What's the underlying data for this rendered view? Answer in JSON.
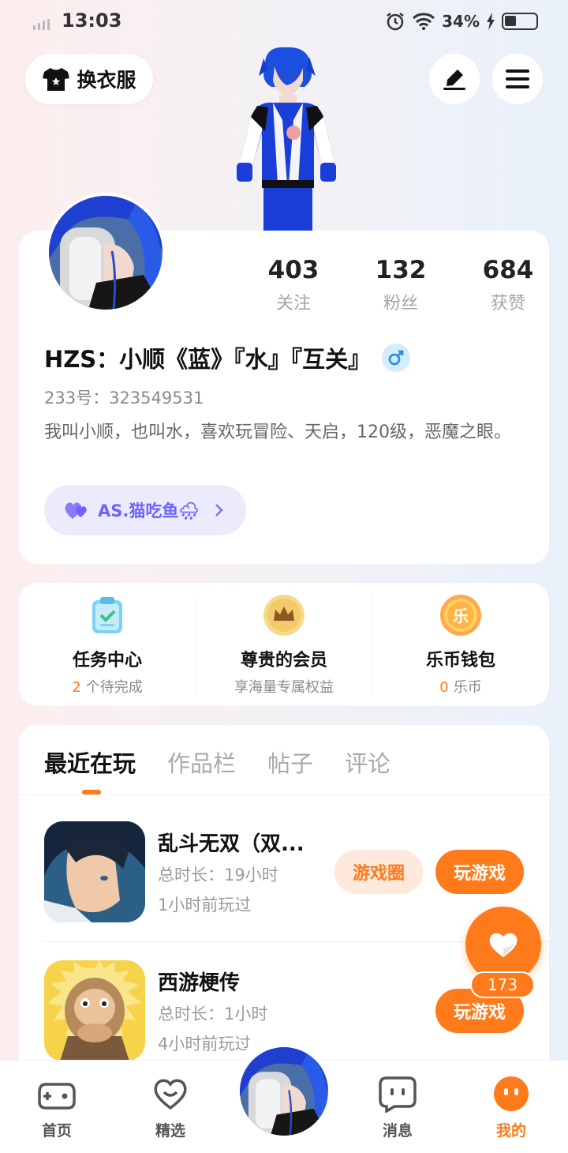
{
  "status_bar": {
    "time": "13:03",
    "battery": "34%"
  },
  "top": {
    "dress_label": "换衣服"
  },
  "profile": {
    "stats": [
      {
        "num": "403",
        "label": "关注"
      },
      {
        "num": "132",
        "label": "粉丝"
      },
      {
        "num": "684",
        "label": "获赞"
      }
    ],
    "username": "HZS：小顺《蓝》『水』『互关』",
    "uid": "233号：323549531",
    "bio": "我叫小顺，也叫水，喜欢玩冒险、天启，120级，恶魔之眼。",
    "club": "AS.猫吃鱼🌧"
  },
  "services": [
    {
      "title": "任务中心",
      "highlight": "2",
      "sub": "个待完成"
    },
    {
      "title": "尊贵的会员",
      "highlight": "",
      "sub": "享海量专属权益"
    },
    {
      "title": "乐币钱包",
      "highlight": "0",
      "sub": "乐币"
    }
  ],
  "tabs": [
    "最近在玩",
    "作品栏",
    "帖子",
    "评论"
  ],
  "games": [
    {
      "name": "乱斗无双（双...",
      "duration": "总时长：19小时",
      "last_played": "1小时前玩过",
      "circle_label": "游戏圈",
      "play_label": "玩游戏"
    },
    {
      "name": "西游梗传",
      "duration": "总时长：1小时",
      "last_played": "4小时前玩过",
      "play_label": "玩游戏"
    }
  ],
  "like_count": "173",
  "nav": {
    "home": "首页",
    "featured": "精选",
    "messages": "消息",
    "mine": "我的"
  },
  "colors": {
    "accent": "#ff7a1a",
    "club_text": "#6c63ff",
    "gender_blue": "#2f8fe6"
  }
}
